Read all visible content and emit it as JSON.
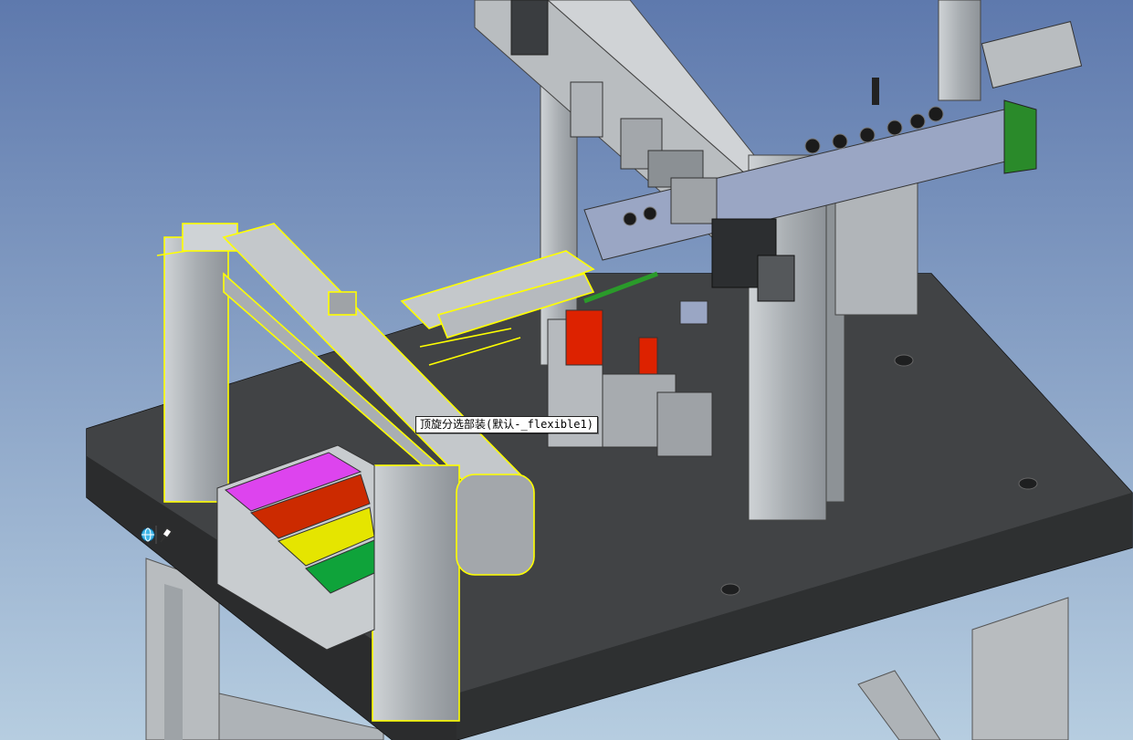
{
  "viewport": {
    "background_top": "#5e79ad",
    "background_bottom": "#b6cde0",
    "selection_color": "#ffff00",
    "tray_colors": {
      "magenta": "#dd44ee",
      "red": "#cc2a00",
      "yellow": "#e5e500",
      "green": "#0fa33a"
    }
  },
  "tooltip": {
    "text": "顶旋分选部装(默认-_flexible1)"
  },
  "icons": {
    "view_cube": "globe-icon",
    "pin": "pushpin-icon"
  }
}
